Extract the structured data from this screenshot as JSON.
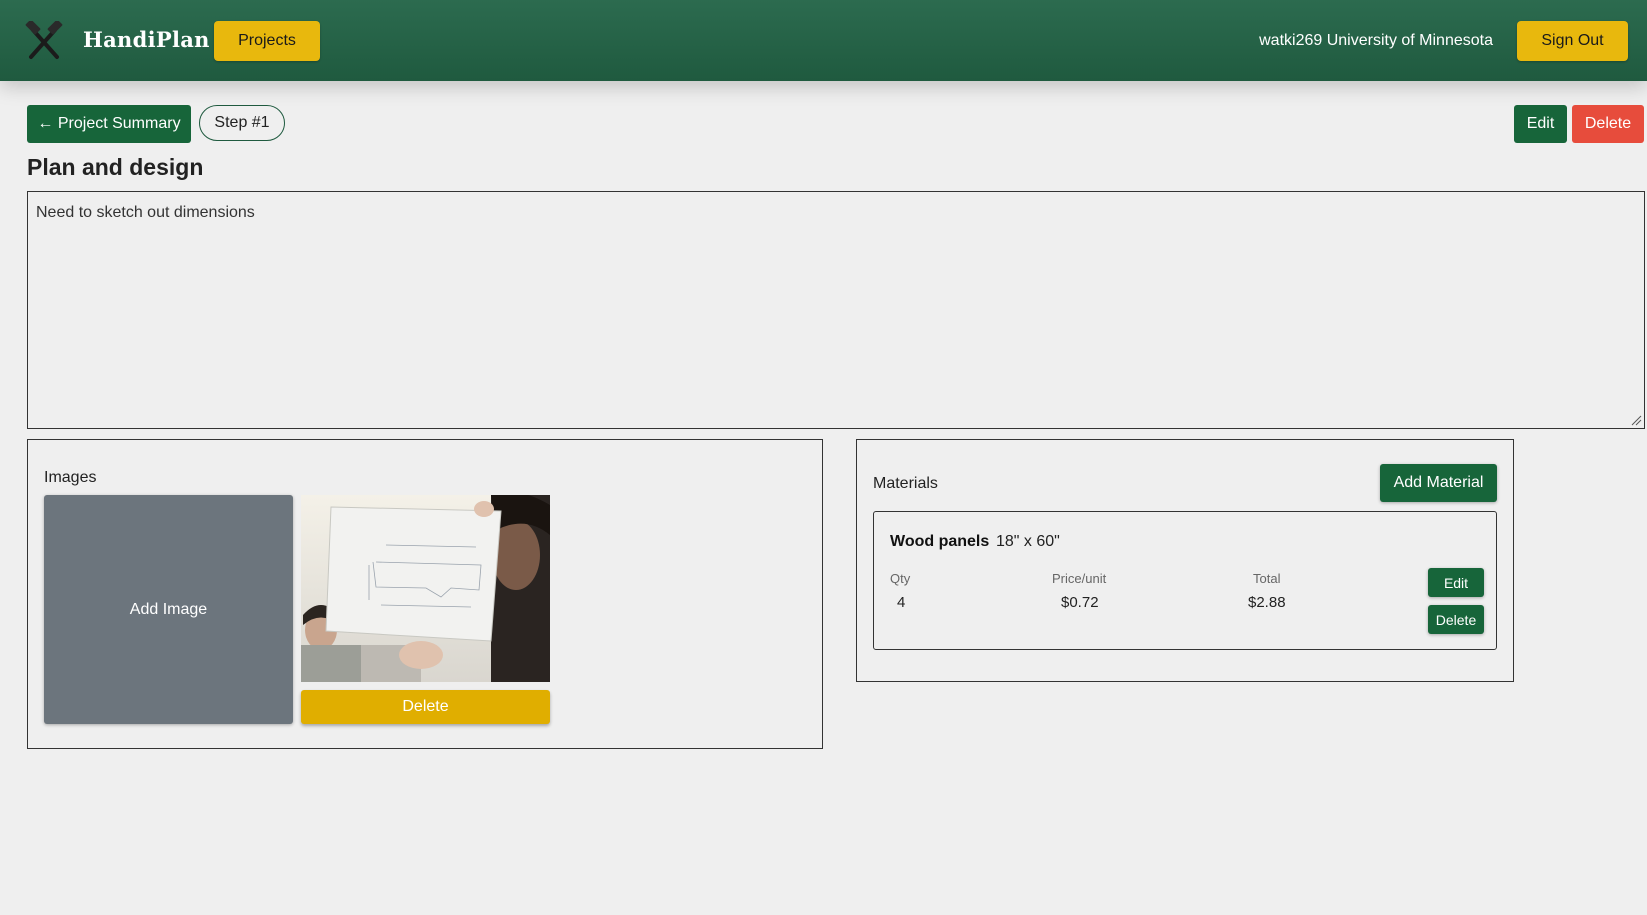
{
  "header": {
    "brand": "HandiPlan",
    "logo_icon": "crossed-hammers-icon",
    "projects_label": "Projects",
    "user_label": "watki269 University of Minnesota",
    "signout_label": "Sign Out",
    "colors": {
      "bar": "#1f5a3f",
      "accent": "#e8b80d"
    }
  },
  "actions": {
    "back_label": "← Project Summary",
    "step_label": "Step #1",
    "edit_label": "Edit",
    "delete_label": "Delete"
  },
  "step": {
    "title": "Plan and design",
    "notes": "Need to sketch out dimensions"
  },
  "images": {
    "label": "Images",
    "add_label": "Add Image",
    "delete_label": "Delete"
  },
  "materials": {
    "label": "Materials",
    "add_label": "Add Material",
    "items": [
      {
        "name": "Wood panels",
        "dimensions": "18\" x 60\"",
        "qty_label": "Qty",
        "price_label": "Price/unit",
        "total_label": "Total",
        "qty": "4",
        "price": "$0.72",
        "total": "$2.88",
        "edit_label": "Edit",
        "delete_label": "Delete"
      }
    ]
  }
}
